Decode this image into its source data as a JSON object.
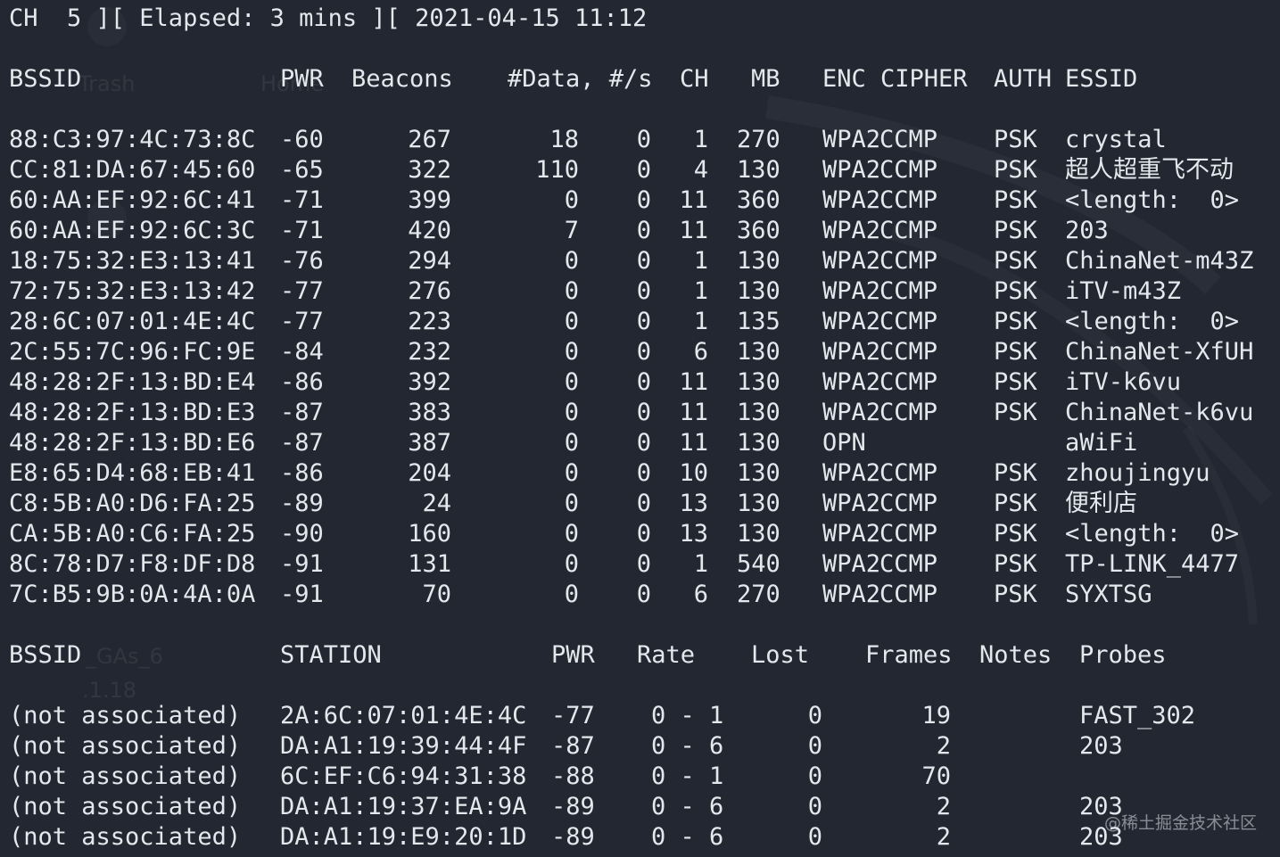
{
  "status_line": {
    "channel": "CH  5 ][ Elapsed: 3 mins ][ 2021-04-15 11:12"
  },
  "ap_table": {
    "headers": {
      "bssid": "BSSID",
      "pwr": "PWR",
      "beacons": "Beacons",
      "data": "#Data, #/s",
      "ch": "CH",
      "mb": "MB",
      "enc_cipher": "ENC CIPHER",
      "auth": "AUTH",
      "essid": "ESSID"
    },
    "rows": [
      {
        "bssid": "88:C3:97:4C:73:8C",
        "pwr": "-60",
        "beacons": "267",
        "data": "18",
        "rate": "0",
        "ch": "1",
        "mb": "270",
        "enc": "WPA2",
        "cipher": "CCMP",
        "auth": "PSK",
        "essid": "crystal"
      },
      {
        "bssid": "CC:81:DA:67:45:60",
        "pwr": "-65",
        "beacons": "322",
        "data": "110",
        "rate": "0",
        "ch": "4",
        "mb": "130",
        "enc": "WPA2",
        "cipher": "CCMP",
        "auth": "PSK",
        "essid": "超人超重飞不动"
      },
      {
        "bssid": "60:AA:EF:92:6C:41",
        "pwr": "-71",
        "beacons": "399",
        "data": "0",
        "rate": "0",
        "ch": "11",
        "mb": "360",
        "enc": "WPA2",
        "cipher": "CCMP",
        "auth": "PSK",
        "essid": "<length:  0>"
      },
      {
        "bssid": "60:AA:EF:92:6C:3C",
        "pwr": "-71",
        "beacons": "420",
        "data": "7",
        "rate": "0",
        "ch": "11",
        "mb": "360",
        "enc": "WPA2",
        "cipher": "CCMP",
        "auth": "PSK",
        "essid": "203"
      },
      {
        "bssid": "18:75:32:E3:13:41",
        "pwr": "-76",
        "beacons": "294",
        "data": "0",
        "rate": "0",
        "ch": "1",
        "mb": "130",
        "enc": "WPA2",
        "cipher": "CCMP",
        "auth": "PSK",
        "essid": "ChinaNet-m43Z"
      },
      {
        "bssid": "72:75:32:E3:13:42",
        "pwr": "-77",
        "beacons": "276",
        "data": "0",
        "rate": "0",
        "ch": "1",
        "mb": "130",
        "enc": "WPA2",
        "cipher": "CCMP",
        "auth": "PSK",
        "essid": "iTV-m43Z"
      },
      {
        "bssid": "28:6C:07:01:4E:4C",
        "pwr": "-77",
        "beacons": "223",
        "data": "0",
        "rate": "0",
        "ch": "1",
        "mb": "135",
        "enc": "WPA2",
        "cipher": "CCMP",
        "auth": "PSK",
        "essid": "<length:  0>"
      },
      {
        "bssid": "2C:55:7C:96:FC:9E",
        "pwr": "-84",
        "beacons": "232",
        "data": "0",
        "rate": "0",
        "ch": "6",
        "mb": "130",
        "enc": "WPA2",
        "cipher": "CCMP",
        "auth": "PSK",
        "essid": "ChinaNet-XfUH"
      },
      {
        "bssid": "48:28:2F:13:BD:E4",
        "pwr": "-86",
        "beacons": "392",
        "data": "0",
        "rate": "0",
        "ch": "11",
        "mb": "130",
        "enc": "WPA2",
        "cipher": "CCMP",
        "auth": "PSK",
        "essid": "iTV-k6vu"
      },
      {
        "bssid": "48:28:2F:13:BD:E3",
        "pwr": "-87",
        "beacons": "383",
        "data": "0",
        "rate": "0",
        "ch": "11",
        "mb": "130",
        "enc": "WPA2",
        "cipher": "CCMP",
        "auth": "PSK",
        "essid": "ChinaNet-k6vu"
      },
      {
        "bssid": "48:28:2F:13:BD:E6",
        "pwr": "-87",
        "beacons": "387",
        "data": "0",
        "rate": "0",
        "ch": "11",
        "mb": "130",
        "enc": "OPN",
        "cipher": "",
        "auth": "",
        "essid": "aWiFi"
      },
      {
        "bssid": "E8:65:D4:68:EB:41",
        "pwr": "-86",
        "beacons": "204",
        "data": "0",
        "rate": "0",
        "ch": "10",
        "mb": "130",
        "enc": "WPA2",
        "cipher": "CCMP",
        "auth": "PSK",
        "essid": "zhoujingyu"
      },
      {
        "bssid": "C8:5B:A0:D6:FA:25",
        "pwr": "-89",
        "beacons": "24",
        "data": "0",
        "rate": "0",
        "ch": "13",
        "mb": "130",
        "enc": "WPA2",
        "cipher": "CCMP",
        "auth": "PSK",
        "essid": "便利店"
      },
      {
        "bssid": "CA:5B:A0:C6:FA:25",
        "pwr": "-90",
        "beacons": "160",
        "data": "0",
        "rate": "0",
        "ch": "13",
        "mb": "130",
        "enc": "WPA2",
        "cipher": "CCMP",
        "auth": "PSK",
        "essid": "<length:  0>"
      },
      {
        "bssid": "8C:78:D7:F8:DF:D8",
        "pwr": "-91",
        "beacons": "131",
        "data": "0",
        "rate": "0",
        "ch": "1",
        "mb": "540",
        "enc": "WPA2",
        "cipher": "CCMP",
        "auth": "PSK",
        "essid": "TP-LINK_4477"
      },
      {
        "bssid": "7C:B5:9B:0A:4A:0A",
        "pwr": "-91",
        "beacons": "70",
        "data": "0",
        "rate": "0",
        "ch": "6",
        "mb": "270",
        "enc": "WPA2",
        "cipher": "CCMP",
        "auth": "PSK",
        "essid": "SYXTSG"
      }
    ]
  },
  "station_table": {
    "headers": {
      "bssid": "BSSID",
      "station": "STATION",
      "pwr": "PWR",
      "rate": "Rate",
      "lost": "Lost",
      "frames": "Frames",
      "notes": "Notes",
      "probes": "Probes"
    },
    "rows": [
      {
        "bssid": "(not associated)",
        "station": "2A:6C:07:01:4E:4C",
        "pwr": "-77",
        "rate": "0 - 1",
        "lost": "0",
        "frames": "19",
        "notes": "",
        "probes": "FAST_302"
      },
      {
        "bssid": "(not associated)",
        "station": "DA:A1:19:39:44:4F",
        "pwr": "-87",
        "rate": "0 - 6",
        "lost": "0",
        "frames": "2",
        "notes": "",
        "probes": "203"
      },
      {
        "bssid": "(not associated)",
        "station": "6C:EF:C6:94:31:38",
        "pwr": "-88",
        "rate": "0 - 1",
        "lost": "0",
        "frames": "70",
        "notes": "",
        "probes": ""
      },
      {
        "bssid": "(not associated)",
        "station": "DA:A1:19:37:EA:9A",
        "pwr": "-89",
        "rate": "0 - 6",
        "lost": "0",
        "frames": "2",
        "notes": "",
        "probes": "203"
      },
      {
        "bssid": "(not associated)",
        "station": "DA:A1:19:E9:20:1D",
        "pwr": "-89",
        "rate": "0 - 6",
        "lost": "0",
        "frames": "2",
        "notes": "",
        "probes": "203"
      }
    ]
  },
  "desktop_ghosts": {
    "trash": "Trash",
    "home": "Home",
    "gas": "_GAs_6",
    "ip": ".1.18"
  },
  "watermark": "@稀土掘金技术社区",
  "colors": {
    "background": "#232731",
    "text": "#e4e7ec"
  }
}
